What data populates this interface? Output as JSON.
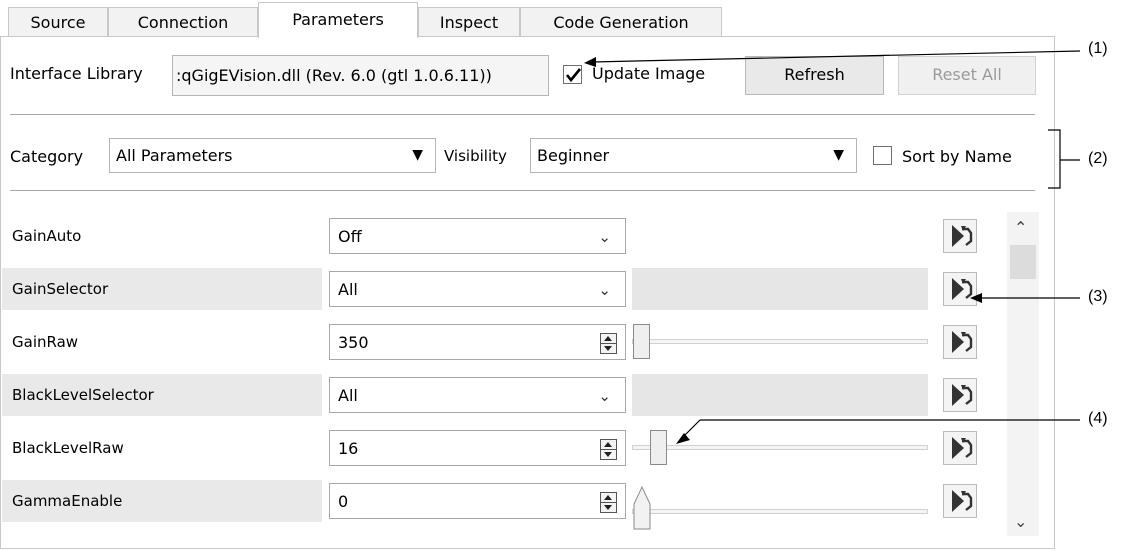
{
  "tabs": [
    "Source",
    "Connection",
    "Parameters",
    "Inspect",
    "Code Generation"
  ],
  "active_tab": "Parameters",
  "interface": {
    "label": "Interface Library",
    "value": ":qGigEVision.dll (Rev. 6.0 (gtl 1.0.6.11))",
    "update_image_label": "Update Image",
    "update_image_checked": true,
    "refresh_label": "Refresh",
    "reset_all_label": "Reset All"
  },
  "filter": {
    "category_label": "Category",
    "category_value": "All Parameters",
    "visibility_label": "Visibility",
    "visibility_value": "Beginner",
    "sort_label": "Sort by Name",
    "sort_checked": false
  },
  "params": [
    {
      "name": "GainAuto",
      "value": "Off",
      "kind": "combo"
    },
    {
      "name": "GainSelector",
      "value": "All",
      "kind": "combo"
    },
    {
      "name": "GainRaw",
      "value": "350",
      "kind": "spin"
    },
    {
      "name": "BlackLevelSelector",
      "value": "All",
      "kind": "combo"
    },
    {
      "name": "BlackLevelRaw",
      "value": "16",
      "kind": "spin"
    },
    {
      "name": "GammaEnable",
      "value": "0",
      "kind": "spin"
    }
  ],
  "callouts": [
    "(1)",
    "(2)",
    "(3)",
    "(4)"
  ]
}
